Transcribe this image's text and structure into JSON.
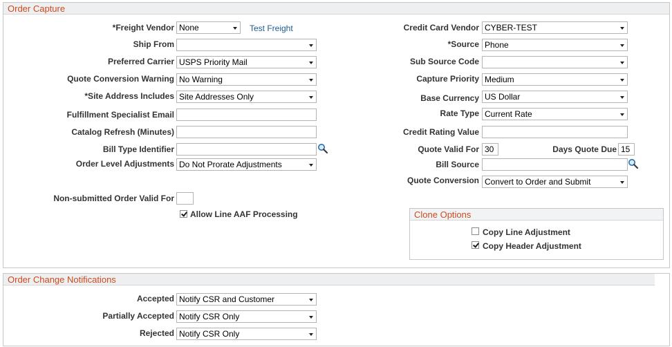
{
  "order_capture": {
    "title": "Order Capture",
    "freight_vendor": {
      "label": "*Freight Vendor",
      "value": "None",
      "link": "Test Freight"
    },
    "ship_from": {
      "label": "Ship From",
      "value": ""
    },
    "preferred_carrier": {
      "label": "Preferred Carrier",
      "value": "USPS Priority Mail"
    },
    "quote_conversion_warning": {
      "label": "Quote Conversion Warning",
      "value": "No Warning"
    },
    "site_address_includes": {
      "label": "*Site Address Includes",
      "value": "Site Addresses Only"
    },
    "fulfillment_specialist_email": {
      "label": "Fulfillment Specialist Email",
      "value": ""
    },
    "catalog_refresh": {
      "label": "Catalog Refresh (Minutes)",
      "value": ""
    },
    "bill_type_identifier": {
      "label": "Bill Type Identifier",
      "value": ""
    },
    "order_level_adjustments": {
      "label": "Order Level Adjustments",
      "value": "Do Not Prorate Adjustments"
    },
    "non_submitted_valid_for": {
      "label": "Non-submitted Order Valid For",
      "value": ""
    },
    "allow_line_aaf": {
      "label": "Allow Line AAF Processing",
      "checked": true
    },
    "credit_card_vendor": {
      "label": "Credit Card Vendor",
      "value": "CYBER-TEST"
    },
    "source": {
      "label": "*Source",
      "value": "Phone"
    },
    "sub_source_code": {
      "label": "Sub Source Code",
      "value": ""
    },
    "capture_priority": {
      "label": "Capture Priority",
      "value": "Medium"
    },
    "base_currency": {
      "label": "Base Currency",
      "value": "US Dollar"
    },
    "rate_type": {
      "label": "Rate Type",
      "value": "Current Rate"
    },
    "credit_rating_value": {
      "label": "Credit Rating Value",
      "value": ""
    },
    "quote_valid_for": {
      "label": "Quote Valid For",
      "value": "30"
    },
    "days_quote_due": {
      "label": "Days Quote Due",
      "value": "15"
    },
    "bill_source": {
      "label": "Bill Source",
      "value": ""
    },
    "quote_conversion": {
      "label": "Quote Conversion",
      "value": "Convert to Order and Submit"
    }
  },
  "clone_options": {
    "title": "Clone Options",
    "copy_line_adjustment": {
      "label": "Copy Line Adjustment",
      "checked": false
    },
    "copy_header_adjustment": {
      "label": "Copy Header Adjustment",
      "checked": true
    }
  },
  "order_change_notifications": {
    "title": "Order Change Notifications",
    "accepted": {
      "label": "Accepted",
      "value": "Notify CSR and Customer"
    },
    "partially_accepted": {
      "label": "Partially Accepted",
      "value": "Notify CSR Only"
    },
    "rejected": {
      "label": "Rejected",
      "value": "Notify CSR Only"
    }
  },
  "icons": {
    "lookup": "magnifier-icon",
    "dropdown": "chevron-down-icon",
    "checkmark": "checkmark-icon"
  }
}
